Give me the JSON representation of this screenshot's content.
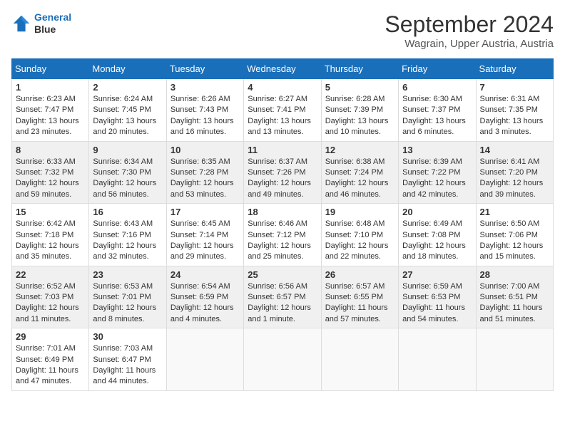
{
  "logo": {
    "line1": "General",
    "line2": "Blue"
  },
  "title": "September 2024",
  "location": "Wagrain, Upper Austria, Austria",
  "days_of_week": [
    "Sunday",
    "Monday",
    "Tuesday",
    "Wednesday",
    "Thursday",
    "Friday",
    "Saturday"
  ],
  "weeks": [
    [
      {
        "day": "1",
        "info": "Sunrise: 6:23 AM\nSunset: 7:47 PM\nDaylight: 13 hours\nand 23 minutes."
      },
      {
        "day": "2",
        "info": "Sunrise: 6:24 AM\nSunset: 7:45 PM\nDaylight: 13 hours\nand 20 minutes."
      },
      {
        "day": "3",
        "info": "Sunrise: 6:26 AM\nSunset: 7:43 PM\nDaylight: 13 hours\nand 16 minutes."
      },
      {
        "day": "4",
        "info": "Sunrise: 6:27 AM\nSunset: 7:41 PM\nDaylight: 13 hours\nand 13 minutes."
      },
      {
        "day": "5",
        "info": "Sunrise: 6:28 AM\nSunset: 7:39 PM\nDaylight: 13 hours\nand 10 minutes."
      },
      {
        "day": "6",
        "info": "Sunrise: 6:30 AM\nSunset: 7:37 PM\nDaylight: 13 hours\nand 6 minutes."
      },
      {
        "day": "7",
        "info": "Sunrise: 6:31 AM\nSunset: 7:35 PM\nDaylight: 13 hours\nand 3 minutes."
      }
    ],
    [
      {
        "day": "8",
        "info": "Sunrise: 6:33 AM\nSunset: 7:32 PM\nDaylight: 12 hours\nand 59 minutes."
      },
      {
        "day": "9",
        "info": "Sunrise: 6:34 AM\nSunset: 7:30 PM\nDaylight: 12 hours\nand 56 minutes."
      },
      {
        "day": "10",
        "info": "Sunrise: 6:35 AM\nSunset: 7:28 PM\nDaylight: 12 hours\nand 53 minutes."
      },
      {
        "day": "11",
        "info": "Sunrise: 6:37 AM\nSunset: 7:26 PM\nDaylight: 12 hours\nand 49 minutes."
      },
      {
        "day": "12",
        "info": "Sunrise: 6:38 AM\nSunset: 7:24 PM\nDaylight: 12 hours\nand 46 minutes."
      },
      {
        "day": "13",
        "info": "Sunrise: 6:39 AM\nSunset: 7:22 PM\nDaylight: 12 hours\nand 42 minutes."
      },
      {
        "day": "14",
        "info": "Sunrise: 6:41 AM\nSunset: 7:20 PM\nDaylight: 12 hours\nand 39 minutes."
      }
    ],
    [
      {
        "day": "15",
        "info": "Sunrise: 6:42 AM\nSunset: 7:18 PM\nDaylight: 12 hours\nand 35 minutes."
      },
      {
        "day": "16",
        "info": "Sunrise: 6:43 AM\nSunset: 7:16 PM\nDaylight: 12 hours\nand 32 minutes."
      },
      {
        "day": "17",
        "info": "Sunrise: 6:45 AM\nSunset: 7:14 PM\nDaylight: 12 hours\nand 29 minutes."
      },
      {
        "day": "18",
        "info": "Sunrise: 6:46 AM\nSunset: 7:12 PM\nDaylight: 12 hours\nand 25 minutes."
      },
      {
        "day": "19",
        "info": "Sunrise: 6:48 AM\nSunset: 7:10 PM\nDaylight: 12 hours\nand 22 minutes."
      },
      {
        "day": "20",
        "info": "Sunrise: 6:49 AM\nSunset: 7:08 PM\nDaylight: 12 hours\nand 18 minutes."
      },
      {
        "day": "21",
        "info": "Sunrise: 6:50 AM\nSunset: 7:06 PM\nDaylight: 12 hours\nand 15 minutes."
      }
    ],
    [
      {
        "day": "22",
        "info": "Sunrise: 6:52 AM\nSunset: 7:03 PM\nDaylight: 12 hours\nand 11 minutes."
      },
      {
        "day": "23",
        "info": "Sunrise: 6:53 AM\nSunset: 7:01 PM\nDaylight: 12 hours\nand 8 minutes."
      },
      {
        "day": "24",
        "info": "Sunrise: 6:54 AM\nSunset: 6:59 PM\nDaylight: 12 hours\nand 4 minutes."
      },
      {
        "day": "25",
        "info": "Sunrise: 6:56 AM\nSunset: 6:57 PM\nDaylight: 12 hours\nand 1 minute."
      },
      {
        "day": "26",
        "info": "Sunrise: 6:57 AM\nSunset: 6:55 PM\nDaylight: 11 hours\nand 57 minutes."
      },
      {
        "day": "27",
        "info": "Sunrise: 6:59 AM\nSunset: 6:53 PM\nDaylight: 11 hours\nand 54 minutes."
      },
      {
        "day": "28",
        "info": "Sunrise: 7:00 AM\nSunset: 6:51 PM\nDaylight: 11 hours\nand 51 minutes."
      }
    ],
    [
      {
        "day": "29",
        "info": "Sunrise: 7:01 AM\nSunset: 6:49 PM\nDaylight: 11 hours\nand 47 minutes."
      },
      {
        "day": "30",
        "info": "Sunrise: 7:03 AM\nSunset: 6:47 PM\nDaylight: 11 hours\nand 44 minutes."
      },
      {
        "day": "",
        "info": ""
      },
      {
        "day": "",
        "info": ""
      },
      {
        "day": "",
        "info": ""
      },
      {
        "day": "",
        "info": ""
      },
      {
        "day": "",
        "info": ""
      }
    ]
  ]
}
